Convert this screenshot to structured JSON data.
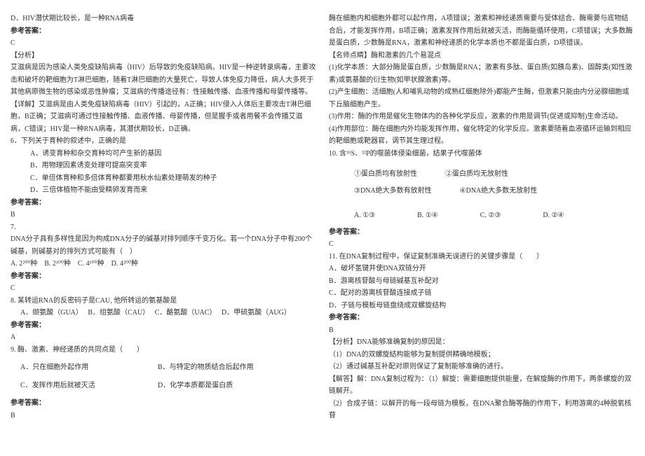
{
  "left": {
    "l1": "D．HIV潜伏期比较长，是一种RNA病毒",
    "l2": "参考答案：",
    "l3": "C",
    "l4": "【分析】",
    "l5": "艾滋病是因为感染人类免疫缺陷病毒（HIV）后导致的免疫缺陷病。HIV是一种逆转录病毒，主要攻击和破坏的靶细胞为T淋巴细胞，随着T淋巴细胞的大量死亡，导致人体免疫力降低，病人大多死于其他病原微生物的感染或恶性肿瘤；艾滋病的传播途径有：性接触传播、血液传播和母婴传播等。",
    "l6": "【详解】艾滋病是由人类免疫缺陷病毒（HIV）引起的，A正确；HIV侵入人体后主要攻击T淋巴细胞，B正确；艾滋病可通过性接触传播、血液传播、母婴传播，但是握手或者用餐不会传播艾滋病，C错误；HIV是一种RNA病毒，其潜伏期较长，D正确。",
    "q6": "6．下列关于育种的叙述中，正确的是",
    "q6a": "A．诱变育种和杂交育种均可产生新的基因",
    "q6b": "B．用物理因素诱变处理可提高突变率",
    "q6c": "C．单倍体育种和多倍体育种都要用秋水仙素处理萌发的种子",
    "q6d": "D．三倍体植物不能由受精卵发育而来",
    "q6ans_label": "参考答案：",
    "q6ans": "B",
    "q7": "7.",
    "q7text": "DNA分子具有多样性是因为构成DNA分子的碱基对排列顺序千变万化。若一个DNA分子中有200个碱基，则碱基对的排列方式可能有（　）",
    "q7opts": "A. 2²⁰⁰种　B. 2¹⁰⁰种　C. 4¹⁰⁰种　D. 4²⁰⁰种",
    "q7ans_label": "参考答案：",
    "q7ans": "C",
    "q8": "8. 某转运RNA的反密码子是CAU, 他所转运的氨基酸是",
    "q8a": "A．缬氨酸（GUA）",
    "q8b": "B．组氨酸（CAU）",
    "q8c": "C．酪氨酸（UAC）",
    "q8d": "D．甲硫氨酸（AUG）",
    "q8ans_label": "参考答案：",
    "q8ans": "A",
    "q9": "9. 酶、激素、神经递质的共同点是（　　）",
    "q9a": "A．只在细胞外起作用",
    "q9b": "B．与特定的物质结合后起作用",
    "q9c": "C．发挥作用后就被灭活",
    "q9d": "D．化学本质都是蛋白质",
    "q9ans_label": "参考答案：",
    "q9ans": "B"
  },
  "right": {
    "r1": "酶在细胞内和细胞外都可以起作用，A项错误；激素和神经递质需要与受体结合、酶需要与底物结合后，才能发挥作用，B项正确；激素发挥作用后就被灭活，而酶能循环使用，C项错误；大多数酶是蛋白质，少数酶是RNA，激素和神经递质的化学本质也不都是蛋白质，D项错误。",
    "r2": "【名师点睛】酶和激素的几个易混点",
    "r3": "(1)化学本质：大部分酶是蛋白质，少数酶是RNA；激素有多肽、蛋白质(如胰岛素)、固醇类(如性激素)或氨基酸的衍生物(如甲状腺激素)等。",
    "r4": "(2)产生细胞：活细胞(人和哺乳动物的成熟红细胞除外)都能产生酶，但激素只能由内分泌腺细胞或下丘脑细胞产生。",
    "r5": "(3)作用：酶的作用是催化生物体内的各种化学反应，激素的作用是调节(促进或抑制)生命活动。",
    "r6": "(4)作用部位：酶在细胞内外均能发挥作用，催化特定的化学反应。激素要随着血液循环运输到相应的靶细胞或靶器官，调节其生理过程。",
    "q10": "10. 含³⁵S、³²P的噬菌体侵染细菌，结果子代噬菌体",
    "q10a": "①蛋白质均有放射性",
    "q10b": "②蛋白质均无放射性",
    "q10c": "③DNA绝大多数有放射性",
    "q10d": "④DNA绝大多数无放射性",
    "q10optA": "A. ①③",
    "q10optB": "B. ①④",
    "q10optC": "C. ②③",
    "q10optD": "D. ②④",
    "q10ans_label": "参考答案：",
    "q10ans": "C",
    "q11": "11. 在DNA复制过程中，保证复制准确无误进行的关键步骤是（　　）",
    "q11a": "A．破坏氢键并使DNA双链分开",
    "q11b": "B．游离核苷酸与母链碱基互补配对",
    "q11c": "C．配对的游离核苷酸连接成子链",
    "q11d": "D．子链与模板母链盘绕成双螺旋结构",
    "q11ans_label": "参考答案：",
    "q11ans": "B",
    "r7": "【分析】DNA能够准确复制的原因是：",
    "r8": "（1）DNA的双螺旋结构能够为复制提供精确地模板；",
    "r9": "（2）通过碱基互补配对原则保证了复制能够准确的进行。",
    "r10": "【解答】解：DNA复制过程为：（1）解旋：需要细胞提供能量，在解旋酶的作用下，两条螺旋的双链解开。",
    "r11": "（2）合成子链：以解开的每一段母链为模板，在DNA聚合酶等酶的作用下，利用游离的4种脱氧核苷"
  }
}
